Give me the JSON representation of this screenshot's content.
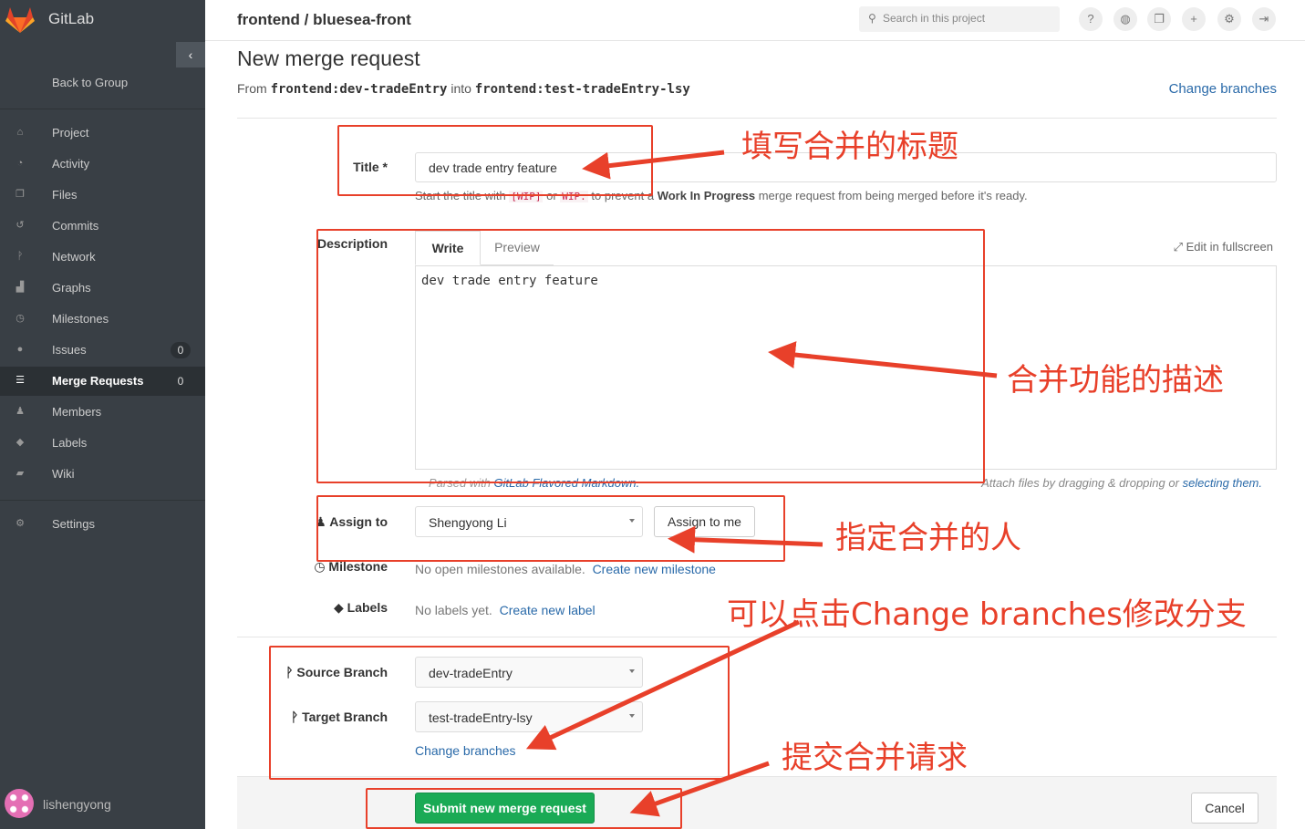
{
  "app": {
    "name": "GitLab",
    "project": "frontend / bluesea-front"
  },
  "sidebar": {
    "back_to_group": "Back to Group",
    "items": [
      {
        "label": "Project",
        "icon": "home-icon"
      },
      {
        "label": "Activity",
        "icon": "dashboard-icon"
      },
      {
        "label": "Files",
        "icon": "files-icon"
      },
      {
        "label": "Commits",
        "icon": "history-icon"
      },
      {
        "label": "Network",
        "icon": "branch-icon"
      },
      {
        "label": "Graphs",
        "icon": "area-chart-icon"
      },
      {
        "label": "Milestones",
        "icon": "clock-icon"
      },
      {
        "label": "Issues",
        "icon": "exclamation-icon",
        "count": "0"
      },
      {
        "label": "Merge Requests",
        "icon": "list-icon",
        "count": "0"
      },
      {
        "label": "Members",
        "icon": "users-icon"
      },
      {
        "label": "Labels",
        "icon": "tags-icon"
      },
      {
        "label": "Wiki",
        "icon": "book-icon"
      }
    ],
    "settings": "Settings",
    "username": "lishengyong"
  },
  "header": {
    "search_placeholder": "Search in this project"
  },
  "page": {
    "title": "New merge request",
    "from_prefix": "From",
    "source_ref": "frontend:dev-tradeEntry",
    "into": "into",
    "target_ref": "frontend:test-tradeEntry-lsy",
    "change_branches": "Change branches"
  },
  "form": {
    "title_label": "Title *",
    "title_value": "dev trade entry feature",
    "title_hint_1": "Start the title with",
    "title_hint_wip1": "[WIP]",
    "title_hint_or": "or",
    "title_hint_wip2": "WIP:",
    "title_hint_2": "to prevent a",
    "title_hint_bold": "Work In Progress",
    "title_hint_3": "merge request from being merged before it's ready.",
    "description_label": "Description",
    "tab_write": "Write",
    "tab_preview": "Preview",
    "edit_fullscreen": "Edit in fullscreen",
    "description_value": "dev trade entry feature",
    "parsed_with": "Parsed with",
    "gfm": "GitLab Flavored Markdown.",
    "attach_hint": "Attach files by dragging & dropping or",
    "selecting_them": "selecting them.",
    "assign_label": "Assign to",
    "assignee": "Shengyong Li",
    "assign_to_me": "Assign to me",
    "milestone_label": "Milestone",
    "milestone_none": "No open milestones available.",
    "create_milestone": "Create new milestone",
    "labels_label": "Labels",
    "labels_none": "No labels yet.",
    "create_label": "Create new label",
    "source_branch_label": "Source Branch",
    "source_branch": "dev-tradeEntry",
    "target_branch_label": "Target Branch",
    "target_branch": "test-tradeEntry-lsy",
    "change_branches": "Change branches",
    "submit": "Submit new merge request",
    "cancel": "Cancel"
  },
  "annotations": {
    "title_note": "填写合并的标题",
    "description_note": "合并功能的描述",
    "assign_note": "指定合并的人",
    "branches_note": "可以点击Change branches修改分支",
    "submit_note": "提交合并请求",
    "color": "#e8402a"
  }
}
